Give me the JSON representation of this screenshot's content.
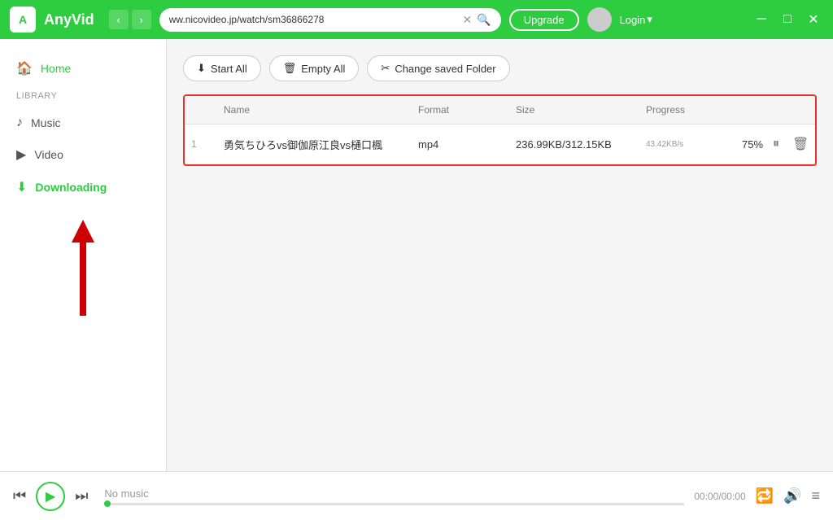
{
  "titleBar": {
    "logoText": "A",
    "appTitle": "AnyVid",
    "urlText": "ww.nicovideo.jp/watch/sm36866278",
    "upgradeLabel": "Upgrade",
    "loginLabel": "Login",
    "navBack": "‹",
    "navForward": "›"
  },
  "sidebar": {
    "homeLabel": "Home",
    "libraryLabel": "Library",
    "musicLabel": "Music",
    "videoLabel": "Video",
    "downloadingLabel": "Downloading"
  },
  "toolbar": {
    "startAllLabel": "Start All",
    "emptyAllLabel": "Empty All",
    "changeFolderLabel": "Change saved Folder"
  },
  "tableHeaders": {
    "col1": "",
    "name": "Name",
    "format": "Format",
    "size": "Size",
    "progress": "Progress"
  },
  "downloadItem": {
    "number": "1",
    "name": "勇気ちひろvs御伽原江良vs樋口楓",
    "format": "mp4",
    "size": "236.99KB/312.15KB",
    "progressPercent": 75,
    "speed": "43.42KB/s",
    "progressLabel": "75%"
  },
  "player": {
    "noMusicLabel": "No music",
    "timeLabel": "00:00/00:00"
  }
}
